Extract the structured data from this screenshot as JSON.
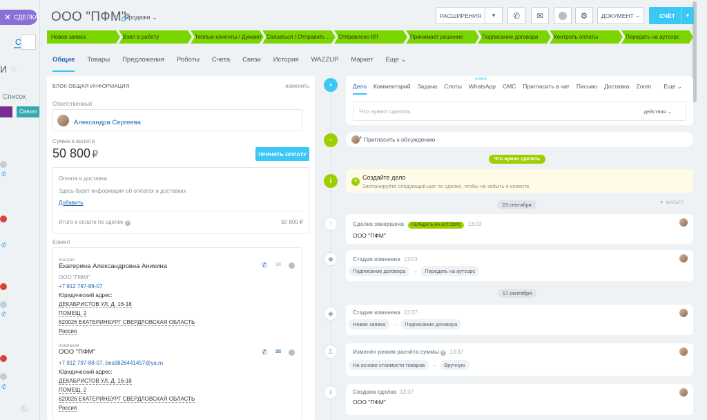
{
  "backdrop": {
    "close_label": "СДЕЛКА",
    "text_i": "И",
    "text_list": "Список",
    "stage_label": "Связат"
  },
  "header": {
    "title": "ООО \"ПФМ\"",
    "pipeline": "Продажи",
    "extensions": "РАСШИРЕНИЯ",
    "document": "ДОКУМЕНТ",
    "invoice": "СЧЁТ"
  },
  "stages": [
    "Новая заявка",
    "Взял в работу",
    "Теплые клиенты / Думают",
    "Связаться / Отправить ф...",
    "Отправлено КП",
    "Принимает решение",
    "Подписание договора",
    "Контроль оплаты",
    "Передать на аутсорс"
  ],
  "tabs": [
    "Общие",
    "Товары",
    "Предложения",
    "Роботы",
    "Счета",
    "Связи",
    "История",
    "WAZZUP",
    "Маркет",
    "Еще"
  ],
  "left": {
    "block_title": "БЛОК ОБЩАЯ ИНФОРМАЦИЯ",
    "block_edit": "изменить",
    "responsible_label": "Ответственный",
    "responsible_name": "Александра Сергеева",
    "amount_label": "Сумма и валюта",
    "amount": "50 800",
    "currency": "₽",
    "pay_button": "ПРИНЯТЬ ОПЛАТУ",
    "payment_title": "Оплата и доставка",
    "payment_info": "Здесь будет информация об оплатах и доставках",
    "payment_add": "Добавить",
    "total_label": "Итого к оплате по сделке",
    "total_value": "50 800 ₽",
    "client_label": "Клиент",
    "contact_type": "Контакт",
    "contact_name": "Екатерина Александровна Аникина",
    "contact_company": "ООО \"ПФМ\"",
    "contact_phone": "+7 912 797-88-07",
    "legal_address_label": "Юридический адрес:",
    "addr1": "ДЕКАБРИСТОВ УЛ, Д. 16-18",
    "addr2": "ПОМЕЩ. 2",
    "addr3": "620026 ЕКАТЕРИНБУРГ СВЕРДЛОВСКАЯ ОБЛАСТЬ",
    "addr4": "Россия",
    "company_type": "Компания",
    "company_name": "ООО \"ПФМ\"",
    "company_contacts": "+7 912 797-88-07, bes9826441457@ya.ru"
  },
  "editor": {
    "tabs": [
      "Дело",
      "Комментарий",
      "Задача",
      "Слоты",
      "WhatsApp",
      "СМС",
      "Пригласить в чат",
      "Письмо",
      "Доставка",
      "Zoom",
      "Еще"
    ],
    "new_badge": "новое",
    "placeholder": "Что нужно сделать",
    "actions": "действия"
  },
  "invite": "Пригласить к обсуждению",
  "need_to_do": "Что нужно сделать",
  "create_task": {
    "title": "Создайте дело",
    "hint": "Запланируйте следующий шаг по сделке, чтобы не забыть о клиенте"
  },
  "dates": {
    "d1": "23 сентября",
    "d2": "17 сентября"
  },
  "filter": "ФИЛЬТР",
  "events": {
    "e1": {
      "title": "Сделка завершена",
      "badge": "ПЕРЕДАТЬ НА АУТСОРС",
      "time": "13:03",
      "text": "ООО \"ПФМ\""
    },
    "e2": {
      "title": "Стадия изменена",
      "time": "13:03",
      "from": "Подписание договора",
      "to": "Передать на аутсорс"
    },
    "e3": {
      "title": "Стадия изменена",
      "time": "13:37",
      "from": "Новая заявка",
      "to": "Подписание договора"
    },
    "e4": {
      "title": "Изменён режим расчёта суммы",
      "time": "13:37",
      "from": "На основе стоимости товаров",
      "to": "Вручную"
    },
    "e5": {
      "title": "Создана сделка",
      "time": "13:37",
      "text": "ООО \"ПФМ\""
    }
  },
  "colors": {
    "accent": "#3bc8f5",
    "stage": "#7bd500",
    "link": "#2066b0",
    "timeline_green": "#9dcf00"
  }
}
